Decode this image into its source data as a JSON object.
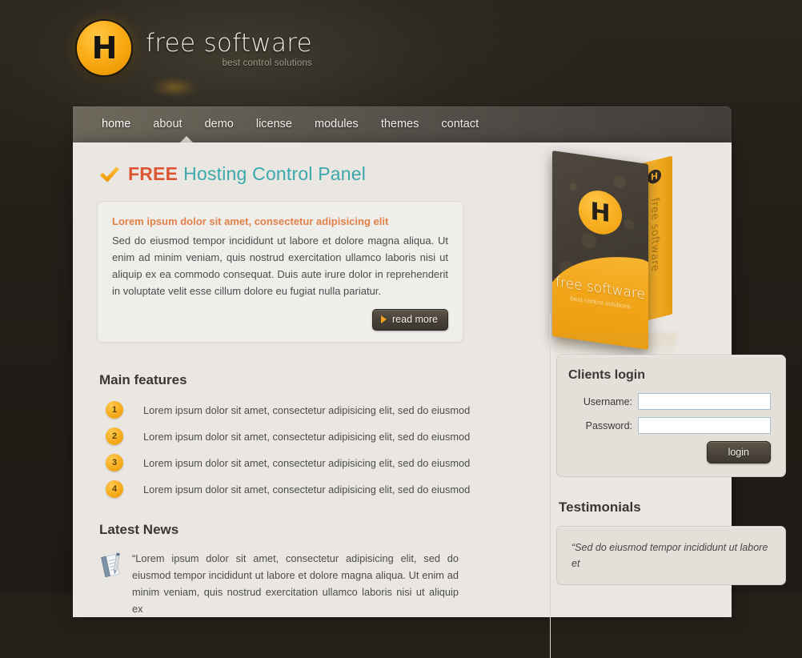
{
  "site": {
    "background_color": "#242019",
    "content_background": "#eae7e3",
    "accent_orange": "#f6ac1e",
    "accent_red": "#dd5533",
    "accent_teal": "#3ba8ab"
  },
  "logo": {
    "mark_letter": "H",
    "brand_name": "free software",
    "tagline": "best control solutions"
  },
  "nav": {
    "items": [
      {
        "label": "home",
        "active": true
      },
      {
        "label": "about",
        "active": false
      },
      {
        "label": "demo",
        "active": false
      },
      {
        "label": "license",
        "active": false
      },
      {
        "label": "modules",
        "active": false
      },
      {
        "label": "themes",
        "active": false
      },
      {
        "label": "contact",
        "active": false
      }
    ]
  },
  "page": {
    "title_free": "FREE",
    "title_rest": "Hosting Control Panel"
  },
  "intro": {
    "heading": "Lorem ipsum dolor sit amet, consectetur adipisicing elit",
    "body": "Sed do eiusmod tempor incididunt ut labore et dolore magna aliqua. Ut enim ad minim veniam, quis nostrud exercitation ullamco laboris nisi ut aliquip ex ea commodo consequat. Duis aute irure dolor in reprehenderit in voluptate velit esse cillum dolore eu fugiat nulla pariatur.",
    "read_more_label": "read more"
  },
  "product_box": {
    "mark_letter": "H",
    "name": "free software",
    "tagline": "best control solutions",
    "spine_text": "free software",
    "spine_letter": "H"
  },
  "features": {
    "heading": "Main features",
    "items": [
      {
        "num": "1",
        "text": "Lorem ipsum dolor sit amet, consectetur adipisicing elit, sed do eiusmod"
      },
      {
        "num": "2",
        "text": "Lorem ipsum dolor sit amet, consectetur adipisicing elit, sed do eiusmod"
      },
      {
        "num": "3",
        "text": "Lorem ipsum dolor sit amet, consectetur adipisicing elit, sed do eiusmod"
      },
      {
        "num": "4",
        "text": "Lorem ipsum dolor sit amet, consectetur adipisicing elit, sed do eiusmod"
      }
    ]
  },
  "news": {
    "heading": "Latest News",
    "text": "“Lorem ipsum dolor sit amet, consectetur adipisicing elit, sed do eiusmod tempor incididunt ut labore et dolore magna aliqua. Ut enim ad minim veniam, quis nostrud exercitation ullamco laboris nisi ut aliquip ex"
  },
  "login": {
    "title": "Clients login",
    "username_label": "Username:",
    "username_value": "",
    "username_placeholder": "",
    "password_label": "Password:",
    "password_value": "",
    "password_placeholder": "",
    "button_label": "login"
  },
  "testimonials": {
    "heading": "Testimonials",
    "quote": "“Sed do eiusmod tempor incididunt ut labore et"
  }
}
